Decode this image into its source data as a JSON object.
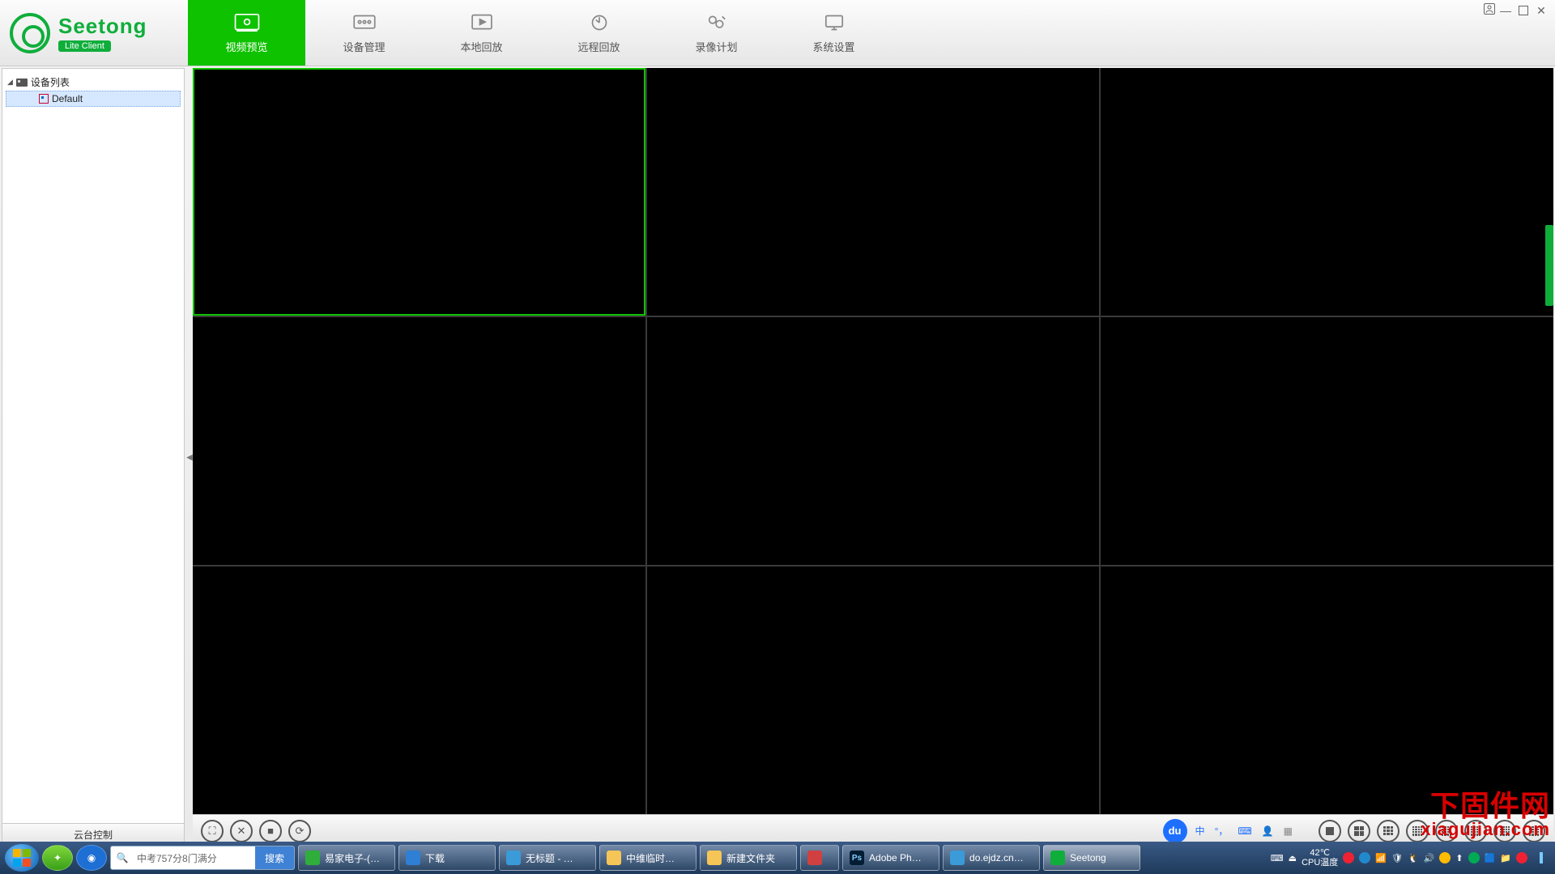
{
  "app": {
    "brand_name": "Seetong",
    "brand_badge": "Lite Client",
    "tabs": [
      {
        "id": "preview",
        "label": "视频预览",
        "active": true
      },
      {
        "id": "device",
        "label": "设备管理",
        "active": false
      },
      {
        "id": "local",
        "label": "本地回放",
        "active": false
      },
      {
        "id": "remote",
        "label": "远程回放",
        "active": false
      },
      {
        "id": "record",
        "label": "录像计划",
        "active": false
      },
      {
        "id": "settings",
        "label": "系统设置",
        "active": false
      }
    ],
    "sidebar": {
      "root_label": "设备列表",
      "children": [
        {
          "label": "Default",
          "selected": true
        }
      ],
      "ptz_label": "云台控制"
    },
    "grid": {
      "rows": 3,
      "cols": 3,
      "selected_index": 0
    },
    "bottom_tools": {
      "left_buttons": [
        "fullscreen-icon",
        "close-all-icon",
        "stop-icon",
        "refresh-icon"
      ],
      "ime_text": "中",
      "grid_options": [
        1,
        4,
        9,
        16,
        25,
        36,
        49,
        64
      ]
    }
  },
  "watermark": {
    "cn": "下固件网",
    "en": "xiagujian.com"
  },
  "taskbar": {
    "search_value": "中考757分8门满分",
    "search_button": "搜索",
    "tasks": [
      {
        "label": "易家电子-(…",
        "color": "#2fae3b"
      },
      {
        "label": "下载",
        "color": "#2f7fd4"
      },
      {
        "label": "无标题 - …",
        "color": "#3a9bd8"
      },
      {
        "label": "中维临时…",
        "color": "#f5c657"
      },
      {
        "label": "新建文件夹",
        "color": "#f5c657"
      },
      {
        "label": "",
        "color": "#d04040",
        "narrow": true
      },
      {
        "label": "Adobe Ph…",
        "color": "#001d34",
        "badge": "Ps"
      },
      {
        "label": "do.ejdz.cn…",
        "color": "#3a9bd8"
      },
      {
        "label": "Seetong",
        "color": "#0fae3b",
        "active": true
      }
    ],
    "temp_value": "42℃",
    "temp_label": "CPU温度"
  }
}
